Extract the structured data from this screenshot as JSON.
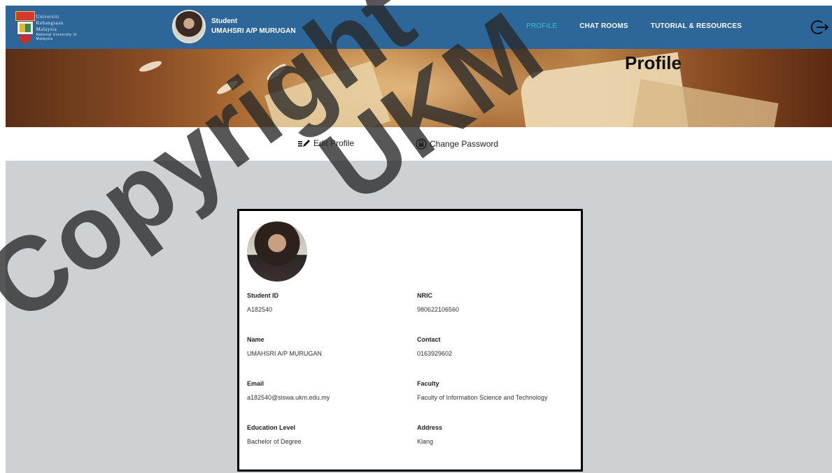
{
  "logo": {
    "lines": [
      "Universiti",
      "Kebangsaan",
      "Malaysia"
    ],
    "sub": "National University of Malaysia"
  },
  "user": {
    "role": "Student",
    "name": "UMAHSRI A/P MURUGAN"
  },
  "nav": {
    "items": [
      {
        "label": "PROFILE",
        "active": true
      },
      {
        "label": "CHAT ROOMS",
        "active": false
      },
      {
        "label": "TUTORIAL & RESOURCES",
        "active": false
      }
    ],
    "accent_color": "#33c1d8",
    "bar_color": "#2d6699"
  },
  "banner": {
    "title": "Profile"
  },
  "toolbar": {
    "edit_label": "Edit Profile",
    "password_label": "Change Password"
  },
  "profile": {
    "student_id_label": "Student ID",
    "student_id": "A182540",
    "nric_label": "NRIC",
    "nric": "980622106560",
    "name_label": "Name",
    "name": "UMAHSRI A/P MURUGAN",
    "contact_label": "Contact",
    "contact": "0163929602",
    "email_label": "Email",
    "email": "a182540@siswa.ukm.edu.my",
    "faculty_label": "Faculty",
    "faculty": "Faculty of Information Science and Technology",
    "education_label": "Education Level",
    "education": "Bachelor of Degree",
    "address_label": "Address",
    "address": "Klang"
  },
  "watermark": {
    "text1": "Copyright",
    "text2": "UKM"
  },
  "icons": [
    "logout-icon",
    "edit-icon",
    "lock-icon"
  ]
}
